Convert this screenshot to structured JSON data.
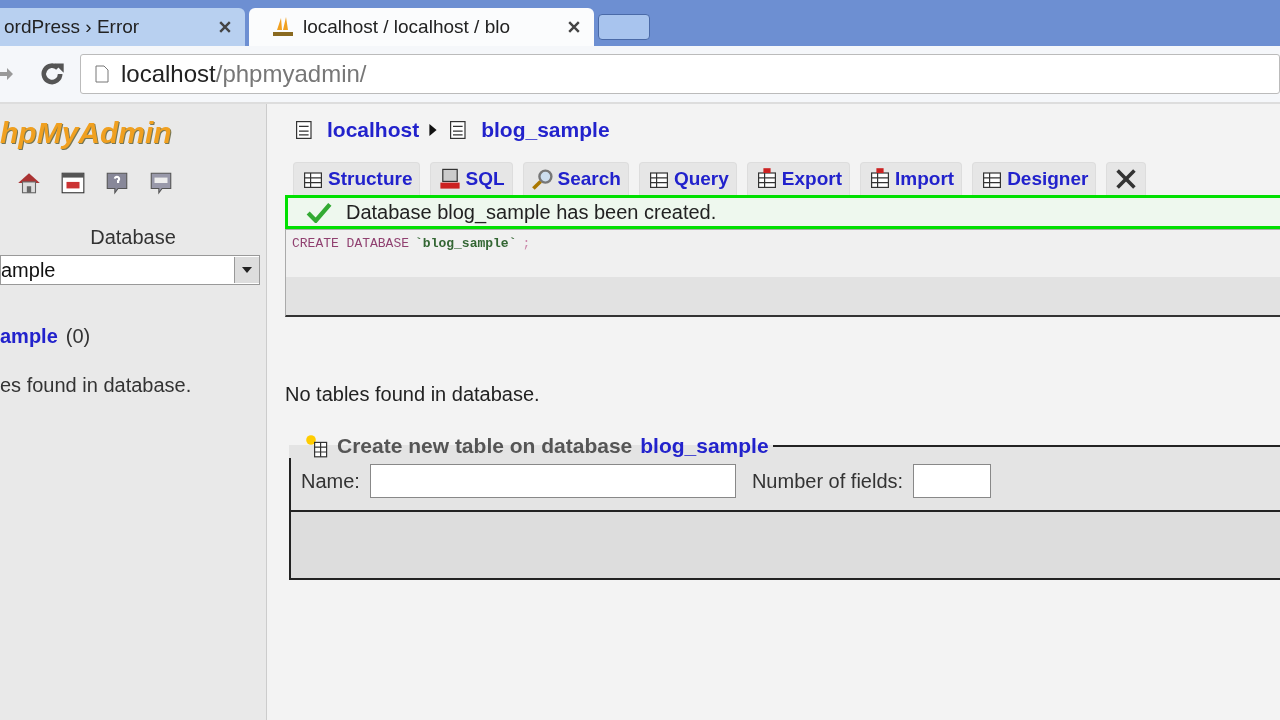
{
  "browser_tabs": [
    {
      "title": "ordPress › Error",
      "selected": false
    },
    {
      "title": "localhost / localhost / blo",
      "selected": true
    }
  ],
  "address_bar": {
    "host": "localhost",
    "path": "/phpmyadmin/"
  },
  "sidebar": {
    "logo": "hpMyAdmin",
    "database_label": "Database",
    "database_select": "ample",
    "database_link": "ample",
    "table_count": "(0)",
    "empty_message": "es found in database."
  },
  "breadcrumb": [
    "localhost",
    "blog_sample"
  ],
  "tabs": [
    {
      "label": "Structure",
      "kind": "structure"
    },
    {
      "label": "SQL",
      "kind": "sql"
    },
    {
      "label": "Search",
      "kind": "search"
    },
    {
      "label": "Query",
      "kind": "query"
    },
    {
      "label": "Export",
      "kind": "export"
    },
    {
      "label": "Import",
      "kind": "import"
    },
    {
      "label": "Designer",
      "kind": "designer"
    },
    {
      "kind": "operations"
    }
  ],
  "success_message": "Database blog_sample has been created.",
  "sql_query": {
    "keywords": "CREATE DATABASE",
    "name": "`blog_sample`",
    "end": ";"
  },
  "no_tables": "No tables found in database.",
  "create_table": {
    "legend": "Create new table on database",
    "database": "blog_sample",
    "name_label": "Name:",
    "fields_label": "Number of fields:"
  }
}
